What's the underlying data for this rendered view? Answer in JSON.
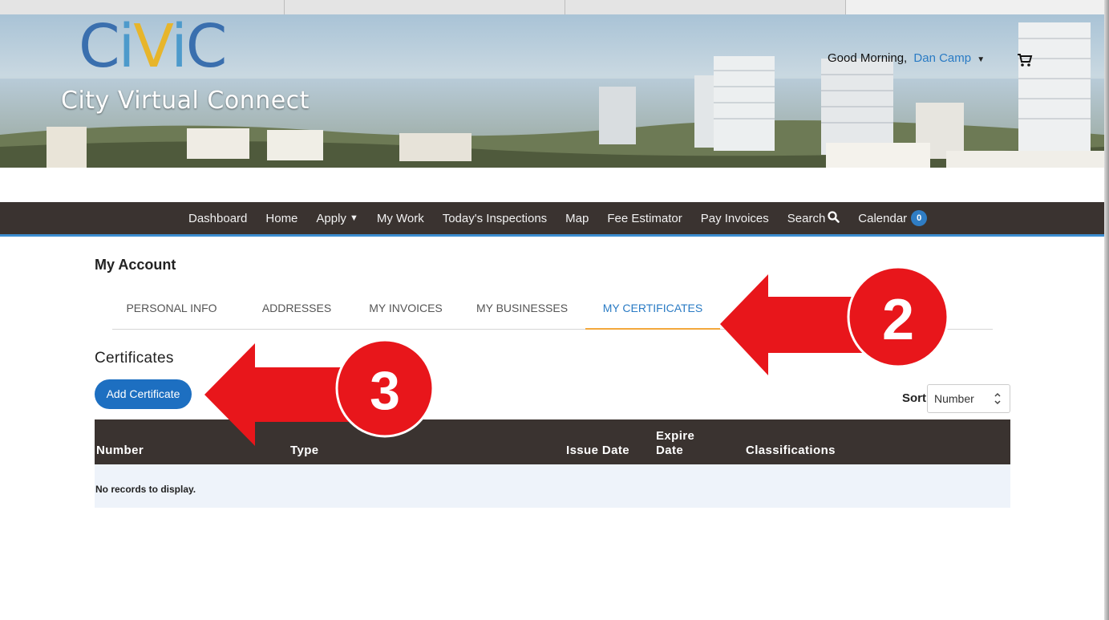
{
  "brand": {
    "logo_word": {
      "c1": "C",
      "i1": "i",
      "v": "V",
      "i2": "i",
      "c2": "C"
    },
    "tagline": "City Virtual Connect"
  },
  "header": {
    "greeting": "Good Morning,",
    "user_name": "Dan Camp",
    "cart_icon": "shopping-cart-icon"
  },
  "nav": {
    "items": [
      {
        "label": "Dashboard"
      },
      {
        "label": "Home"
      },
      {
        "label": "Apply"
      },
      {
        "label": "My Work"
      },
      {
        "label": "Today's Inspections"
      },
      {
        "label": "Map"
      },
      {
        "label": "Fee Estimator"
      },
      {
        "label": "Pay Invoices"
      },
      {
        "label": "Search"
      },
      {
        "label": "Calendar"
      }
    ],
    "calendar_count": "0"
  },
  "account": {
    "title": "My Account",
    "tabs": [
      {
        "label": "PERSONAL INFO"
      },
      {
        "label": "ADDRESSES"
      },
      {
        "label": "MY INVOICES"
      },
      {
        "label": "MY BUSINESSES"
      },
      {
        "label": "MY CERTIFICATES"
      }
    ],
    "active_tab": "MY CERTIFICATES"
  },
  "certificates": {
    "title": "Certificates",
    "add_button": "Add Certificate",
    "sort_label": "Sort",
    "sort_value": "Number",
    "columns": [
      "Number",
      "Type",
      "Issue Date",
      "Expire",
      "Date",
      "Classifications"
    ],
    "empty_message": "No records to display."
  },
  "annotations": {
    "markers": [
      "2",
      "3"
    ],
    "color": "#e8161b"
  },
  "colors": {
    "nav_bg": "#3a3330",
    "accent_blue": "#1d6fc1",
    "tab_underline": "#f3a83b"
  }
}
